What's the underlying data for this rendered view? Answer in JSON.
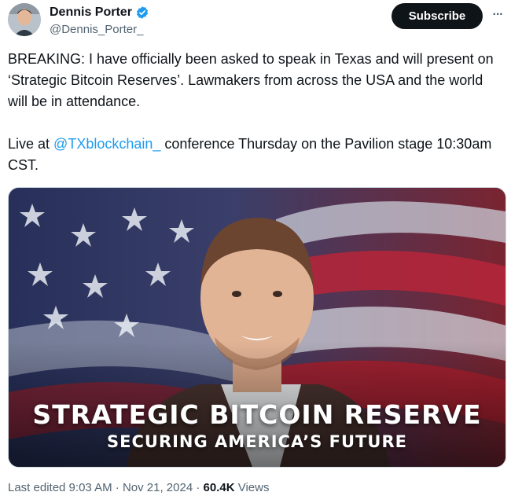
{
  "author": {
    "display_name": "Dennis Porter",
    "handle": "@Dennis_Porter_",
    "avatar_icon": "user-avatar",
    "verified_icon": "verified-badge-icon",
    "verified_color": "#1d9bf0"
  },
  "header": {
    "subscribe_label": "Subscribe",
    "more_label": "···"
  },
  "post": {
    "line1": "BREAKING: I have officially been asked to speak in Texas and will present on ‘Strategic Bitcoin Reserves’. Lawmakers from across the USA and the world will be in attendance.",
    "line2_prefix": "Live at ",
    "mention": "@TXblockchain_",
    "line2_suffix": " conference Thursday on the Pavilion stage 10:30am CST."
  },
  "media": {
    "headline": "STRATEGIC BITCOIN RESERVE",
    "subheadline": "SECURING AMERICA’S FUTURE"
  },
  "meta": {
    "edited": "Last edited 9:03 AM",
    "sep1": " · ",
    "date": "Nov 21, 2024",
    "sep2": " · ",
    "views_count": "60.4K",
    "views_label": " Views"
  },
  "colors": {
    "link": "#1d9bf0",
    "button_bg": "#0f1419",
    "muted": "#536471"
  }
}
